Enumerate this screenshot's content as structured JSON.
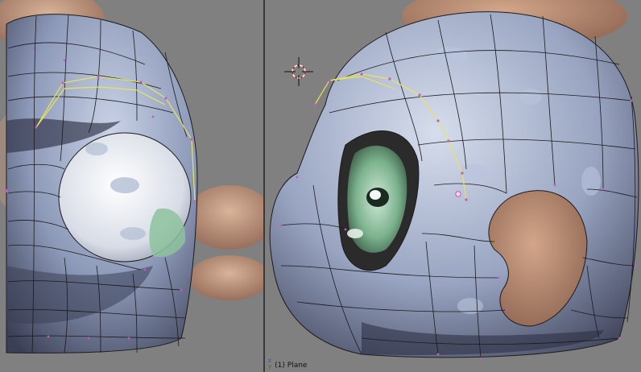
{
  "viewports": {
    "left": {
      "view": "front"
    },
    "right": {
      "view": "side"
    }
  },
  "status": {
    "object_label": "(1) Plane",
    "axis_z": "z",
    "axis_y": "y"
  },
  "colors": {
    "background": "#808080",
    "mesh_fill": "#9aa8c4",
    "mesh_edge": "#1b1b1b",
    "selected_edge": "#e8e55a",
    "vertex": "#c45ac6",
    "skin": "#c29a7d",
    "eye_iris": "#8ec29d",
    "cursor": "#cc2222"
  },
  "icons": [
    "3d-cursor-icon",
    "axis-widget-icon"
  ]
}
